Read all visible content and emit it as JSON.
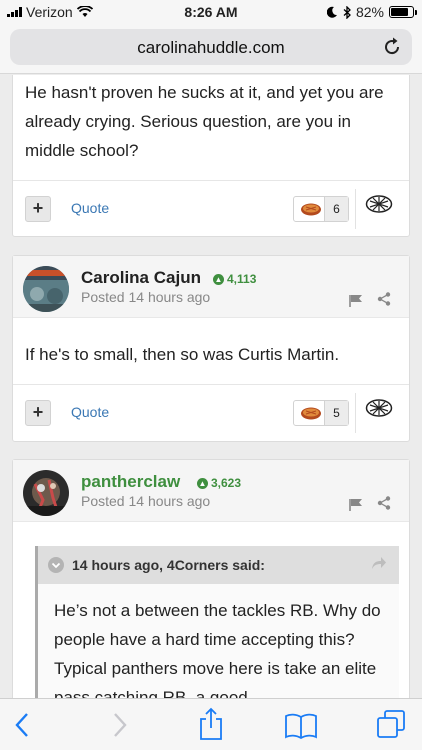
{
  "status": {
    "carrier": "Verizon",
    "time": "8:26 AM",
    "battery": "82%",
    "battery_level": 0.82
  },
  "browser": {
    "url": "carolinahuddle.com",
    "reload_icon": "reload-icon"
  },
  "posts": [
    {
      "text": "He hasn't proven he sucks at it, and yet you are already crying.  Serious question, are you in middle school?",
      "quote_label": "Quote",
      "reaction_count": "6"
    },
    {
      "author": "Carolina Cajun",
      "author_color": "#222222",
      "reputation": "4,113",
      "posted": "Posted 14 hours ago",
      "text": "If he's to small, then so was Curtis Martin.",
      "quote_label": "Quote",
      "reaction_count": "5"
    },
    {
      "author": "pantherclaw",
      "author_color": "#3f8f3f",
      "reputation": "3,623",
      "posted": "Posted 14 hours ago",
      "quote_header": "14 hours ago, 4Corners said:",
      "quote_text": "He’s not a between the tackles RB. Why do people have a hard time accepting this? Typical panthers move here is take an elite pass catching RB, a good"
    }
  ],
  "colors": {
    "accent_link": "#3b78b4",
    "reputation_green": "#3f8f3f",
    "ios_blue": "#1a7cf5"
  }
}
